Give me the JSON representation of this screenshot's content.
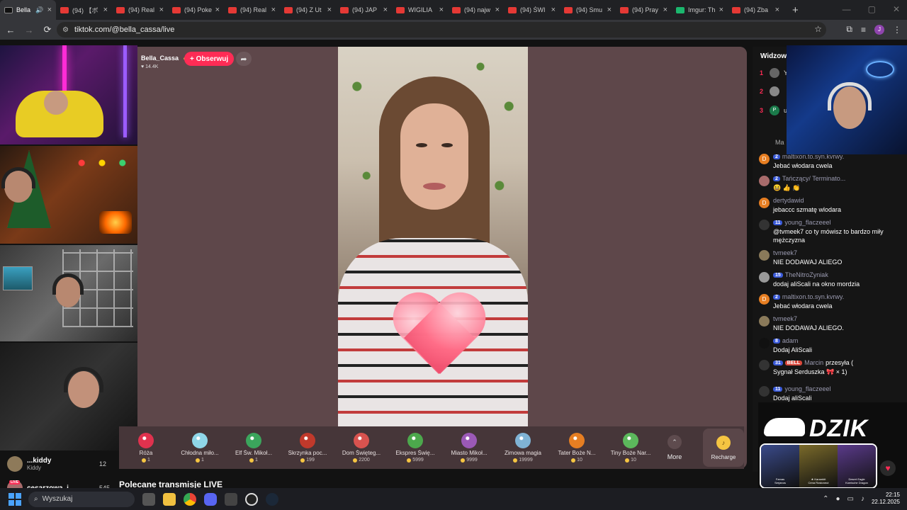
{
  "browser": {
    "tabs": [
      {
        "label": "Bella",
        "favicon": "tiktok-icon",
        "active": true,
        "audio": true
      },
      {
        "label": "(94) 【ボ",
        "favicon": "youtube-icon"
      },
      {
        "label": "(94) Real",
        "favicon": "youtube-icon"
      },
      {
        "label": "(94) Poke",
        "favicon": "youtube-icon"
      },
      {
        "label": "(94) Real",
        "favicon": "youtube-icon"
      },
      {
        "label": "(94) Z Ut",
        "favicon": "youtube-icon"
      },
      {
        "label": "(94) JAP",
        "favicon": "youtube-icon"
      },
      {
        "label": "WIGILIA",
        "favicon": "youtube-icon"
      },
      {
        "label": "(94) najw",
        "favicon": "youtube-icon"
      },
      {
        "label": "(94) ŚWI",
        "favicon": "youtube-icon"
      },
      {
        "label": "(94) Smu",
        "favicon": "youtube-icon"
      },
      {
        "label": "(94) Pray",
        "favicon": "youtube-icon"
      },
      {
        "label": "Imgur: Th",
        "favicon": "imgur-icon"
      },
      {
        "label": "(94) Zba",
        "favicon": "youtube-icon"
      }
    ],
    "url": "tiktok.com/@bella_cassa/live",
    "profile_initial": "J"
  },
  "stream": {
    "host_name": "Bella_Cassa",
    "likes": "14.4K",
    "follow_label": "+ Obserwuj"
  },
  "gifts": [
    {
      "name": "Róża",
      "price": "1",
      "color": "#e0324e"
    },
    {
      "name": "Chłodna miło...",
      "price": "1",
      "color": "#8fd6e8"
    },
    {
      "name": "Elf Św. Mikoł...",
      "price": "1",
      "color": "#3ba55c"
    },
    {
      "name": "Skrzynka poc...",
      "price": "199",
      "color": "#c0392b"
    },
    {
      "name": "Dom Święteg...",
      "price": "2200",
      "color": "#d9534f"
    },
    {
      "name": "Ekspres Świę...",
      "price": "5999",
      "color": "#4ca84c"
    },
    {
      "name": "Miasto Mikoł...",
      "price": "9999",
      "color": "#9b59b6"
    },
    {
      "name": "Zimowa magia",
      "price": "19999",
      "color": "#7fb3d5"
    },
    {
      "name": "Tater Boże N...",
      "price": "10",
      "color": "#e67e22"
    },
    {
      "name": "Tiny Boże Nar...",
      "price": "10",
      "color": "#5cb85c"
    }
  ],
  "gift_more": "More",
  "recharge": "Recharge",
  "sidebar": {
    "entries": [
      {
        "title": "...kiddy",
        "subtitle": "Kiddy",
        "count": "12",
        "color": "#8e7a5a"
      },
      {
        "title": "cesarzowa_i...",
        "subtitle": "",
        "count": "545",
        "color": "#a86b6b"
      }
    ],
    "live_badge": "LIVE",
    "recommended_title": "Polecane transmisje LIVE"
  },
  "chat": {
    "viewers_title": "Widzow",
    "ranking": [
      {
        "rank": "1",
        "text": "Y",
        "color": "#666"
      },
      {
        "rank": "2",
        "text": "",
        "color": "#888"
      },
      {
        "rank": "3",
        "text": "u",
        "color": "#1a7a4a"
      }
    ],
    "ranking_avatar_3_letter": "P",
    "section_label": "Ma",
    "messages": [
      {
        "level": "2",
        "user": "maltixon.to.syn.kvrwy.",
        "text": "Jebać włodara cwela",
        "av": "#e67e22",
        "av_letter": "D"
      },
      {
        "level": "2",
        "user": "Tańczący/ Terminato...",
        "text": "😆 👍 👏",
        "av": "#a86b6b",
        "av_letter": ""
      },
      {
        "level": "",
        "user": "dertydawid",
        "text": "jebaccc szmatę wlodara",
        "av": "#e67e22",
        "av_letter": "D"
      },
      {
        "level": "11",
        "user": "young_flaczeeel",
        "text": "@tvmeek7 co ty mówisz to bardzo miły mężczyzna",
        "av": "#333",
        "av_letter": ""
      },
      {
        "level": "",
        "user": "tvmeek7",
        "text": "NIE DODAWAJ ALIEGO",
        "av": "#8a7a5a",
        "av_letter": ""
      },
      {
        "level": "15",
        "user": "TheNitroZyniak",
        "text": "dodaj aliScali na okno mordzia",
        "av": "#999",
        "av_letter": ""
      },
      {
        "level": "2",
        "user": "maltixon.to.syn.kvrwy.",
        "text": "Jebać włodara cwela",
        "av": "#e67e22",
        "av_letter": "D"
      },
      {
        "level": "",
        "user": "tvmeek7",
        "text": "NIE DODAWAJ ALIEGO.",
        "av": "#8a7a5a",
        "av_letter": ""
      },
      {
        "level": "8",
        "user": "adam",
        "text": "Dodaj AliScali",
        "av": "#111",
        "av_letter": ""
      },
      {
        "level": "31",
        "badge": "BELL",
        "user": "Marcin",
        "suffix": "przesyła (",
        "text": "Sygnał Serduszka 🎀 × 1)",
        "av": "#333",
        "av_letter": ""
      },
      {
        "level": "11",
        "user": "young_flaczeeel",
        "text": "Dodaj aliScali",
        "av": "#333",
        "av_letter": ""
      }
    ]
  },
  "overlay": {
    "brand": "DZIK",
    "cards": [
      {
        "label": "Famas",
        "sub": "Serjanos",
        "color": "#3a4a8a"
      },
      {
        "label": "★ Karambit",
        "sub": "Cena Rostoneut",
        "color": "#7a6a2a"
      },
      {
        "label": "Desert Eagle",
        "sub": "Komische Dragon",
        "color": "#5a3a8a"
      }
    ]
  },
  "taskbar": {
    "search_placeholder": "Wyszukaj",
    "time": "22:15",
    "date": "22.12.2025"
  }
}
